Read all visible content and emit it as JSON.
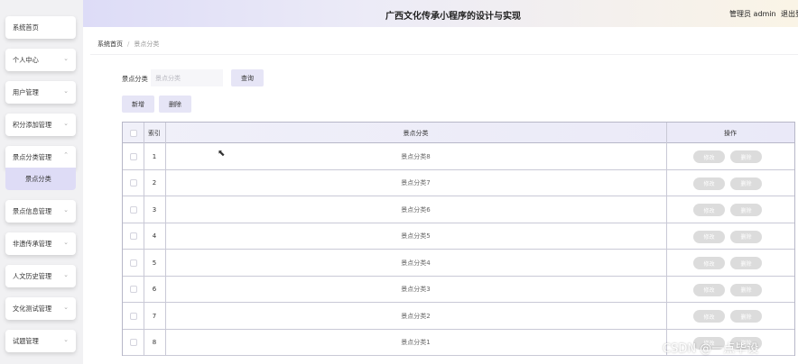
{
  "header": {
    "title": "广西文化传承小程序的设计与实现",
    "admin": "管理员 admin",
    "logout": "退出登"
  },
  "sidebar": {
    "items": [
      {
        "label": "系统首页",
        "chevron": false
      },
      {
        "label": "个人中心",
        "chevron": true
      },
      {
        "label": "用户管理",
        "chevron": true
      },
      {
        "label": "积分添加管理",
        "chevron": true
      },
      {
        "label": "景点分类管理",
        "chevron": true,
        "expanded": true
      },
      {
        "label": "景点信息管理",
        "chevron": true
      },
      {
        "label": "非遗传承管理",
        "chevron": true
      },
      {
        "label": "人文历史管理",
        "chevron": true
      },
      {
        "label": "文化测试管理",
        "chevron": true
      },
      {
        "label": "试题管理",
        "chevron": true
      }
    ],
    "sub_item": "景点分类"
  },
  "breadcrumb": {
    "home": "系统首页",
    "current": "景点分类"
  },
  "search": {
    "label": "景点分类",
    "placeholder": "景点分类",
    "query_button": "查询",
    "add_button": "新增",
    "delete_button": "删除"
  },
  "table": {
    "headers": {
      "index": "索引",
      "category": "景点分类",
      "action": "操作"
    },
    "rows": [
      {
        "index": "1",
        "category": "景点分类8"
      },
      {
        "index": "2",
        "category": "景点分类7"
      },
      {
        "index": "3",
        "category": "景点分类6"
      },
      {
        "index": "4",
        "category": "景点分类5"
      },
      {
        "index": "5",
        "category": "景点分类4"
      },
      {
        "index": "6",
        "category": "景点分类3"
      },
      {
        "index": "7",
        "category": "景点分类2"
      },
      {
        "index": "8",
        "category": "景点分类1"
      }
    ],
    "row_actions": {
      "edit": "修改",
      "delete": "删除"
    }
  },
  "cursor_icon": "arrow-cursor-icon",
  "watermark": "CSDN @一点毕设",
  "colors": {
    "accent": "#dedcf6",
    "header_left": "#dddcf7",
    "header_right": "#faf4e6",
    "action_button": "#dcdcdc"
  }
}
